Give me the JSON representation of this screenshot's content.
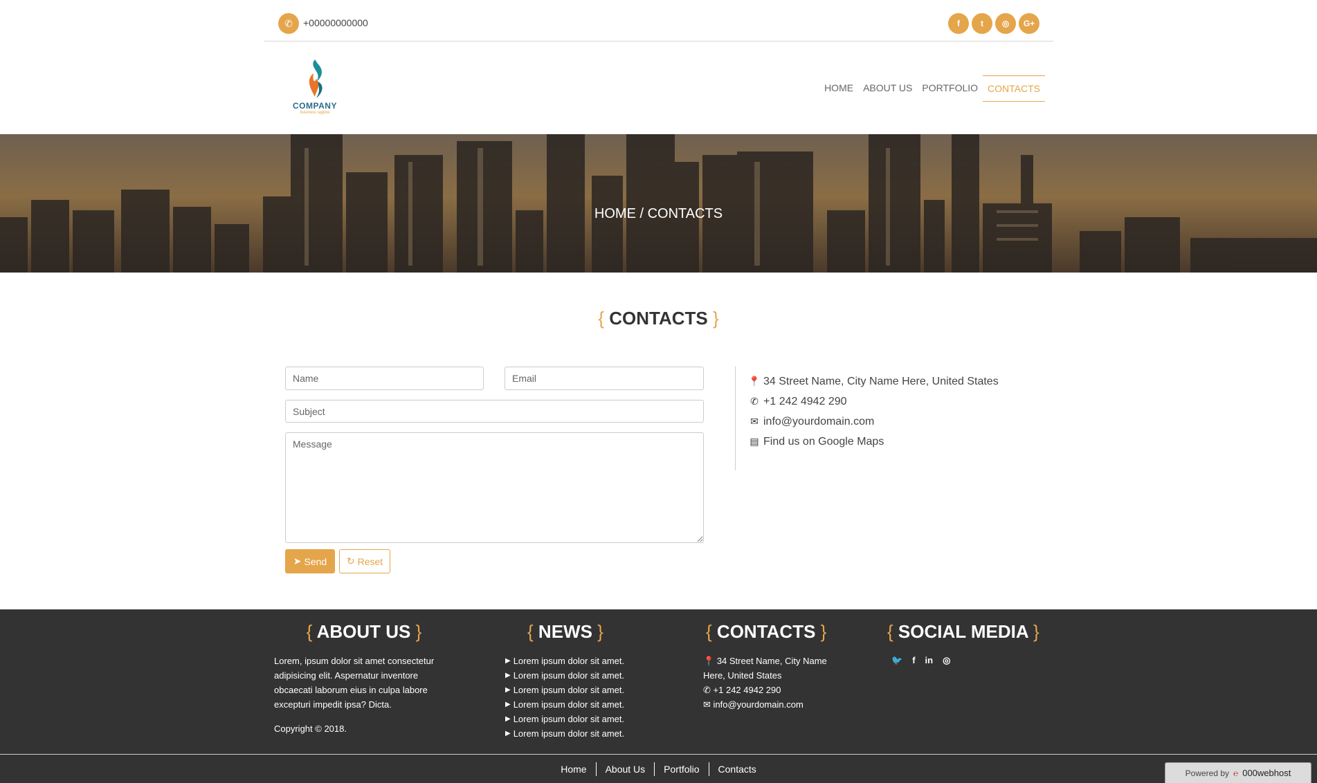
{
  "topbar": {
    "phone": "+00000000000",
    "socials": [
      {
        "icon": "facebook-icon",
        "glyph": "f"
      },
      {
        "icon": "twitter-icon",
        "glyph": "t"
      },
      {
        "icon": "instagram-icon",
        "glyph": "◎"
      },
      {
        "icon": "google-plus-icon",
        "glyph": "G+"
      }
    ]
  },
  "logo": {
    "company": "COMPANY",
    "tagline": "business tagline"
  },
  "nav": {
    "items": [
      "HOME",
      "ABOUT US",
      "PORTFOLIO",
      "CONTACTS"
    ],
    "active": "CONTACTS"
  },
  "banner": {
    "breadcrumb": "HOME / CONTACTS"
  },
  "contacts": {
    "title": "CONTACTS",
    "form": {
      "name_placeholder": "Name",
      "email_placeholder": "Email",
      "subject_placeholder": "Subject",
      "message_placeholder": "Message",
      "send_label": "Send",
      "reset_label": "Reset"
    },
    "info": {
      "address": "34 Street Name, City Name Here, United States",
      "phone": "+1 242 4942 290",
      "email": "info@yourdomain.com",
      "maps": "Find us on Google Maps"
    }
  },
  "footer": {
    "about": {
      "title": "ABOUT US",
      "text": "Lorem, ipsum dolor sit amet consectetur adipisicing elit. Aspernatur inventore obcaecati laborum eius in culpa labore excepturi impedit ipsa? Dicta.",
      "copyright": "Copyright © 2018."
    },
    "news": {
      "title": "NEWS",
      "items": [
        "Lorem ipsum dolor sit amet.",
        "Lorem ipsum dolor sit amet.",
        "Lorem ipsum dolor sit amet.",
        "Lorem ipsum dolor sit amet.",
        "Lorem ipsum dolor sit amet.",
        "Lorem ipsum dolor sit amet."
      ]
    },
    "contacts": {
      "title": "CONTACTS",
      "address_1": "34 Street Name, City Name",
      "address_2": "Here, United States",
      "phone": "+1 242 4942 290",
      "email": "info@yourdomain.com"
    },
    "social": {
      "title": "SOCIAL MEDIA",
      "icons": [
        "twitter-icon",
        "facebook-icon",
        "linkedin-icon",
        "instagram-icon"
      ]
    },
    "links": [
      "Home",
      "About Us",
      "Portfolio",
      "Contacts"
    ],
    "powered_by": "Powered by",
    "host_brand": "000webhost"
  },
  "colors": {
    "accent": "#e5a54b",
    "footer_bg": "#333333"
  }
}
